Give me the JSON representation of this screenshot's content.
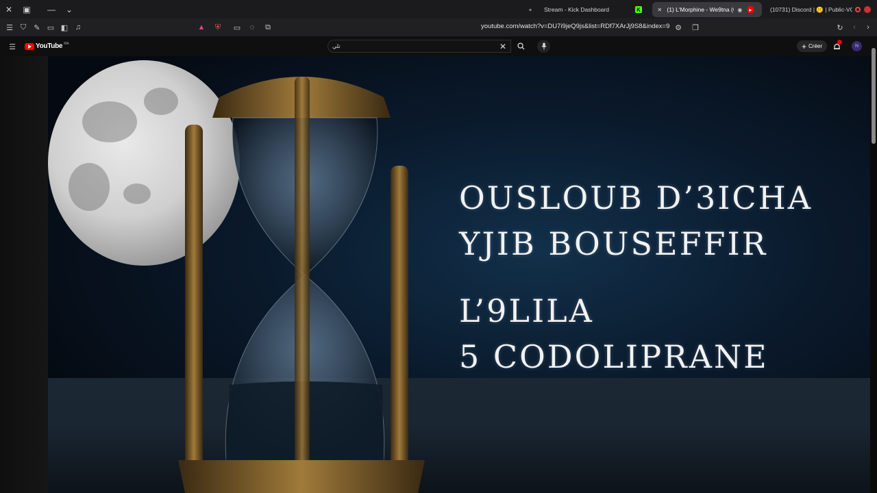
{
  "tabs": [
    {
      "label": "Stream - Kick Dashboard",
      "active": false
    },
    {
      "label": "(1) L'Morphine - We9tna (Offi",
      "active": true
    },
    {
      "label": "(10731) Discord | 🤫 | Public-VC",
      "active": false
    }
  ],
  "address_bar": {
    "url": "youtube.com/watch?v=DU7i9jeQ9js&list=RDf7XArJj9S8&index=9"
  },
  "youtube": {
    "logo_text": "YouTube",
    "region": "MA",
    "search_value": "تلي",
    "create_label": "Créer"
  },
  "video": {
    "lyrics": [
      "OUSLOUB D’3ICHA",
      "YJIB BOUSEFFIR",
      "L’9LILA",
      "5 CODOLIPRANE"
    ]
  },
  "colors": {
    "accent_red": "#ff0000",
    "kick_green": "#53fc18",
    "bg": "#0f0f0f"
  }
}
